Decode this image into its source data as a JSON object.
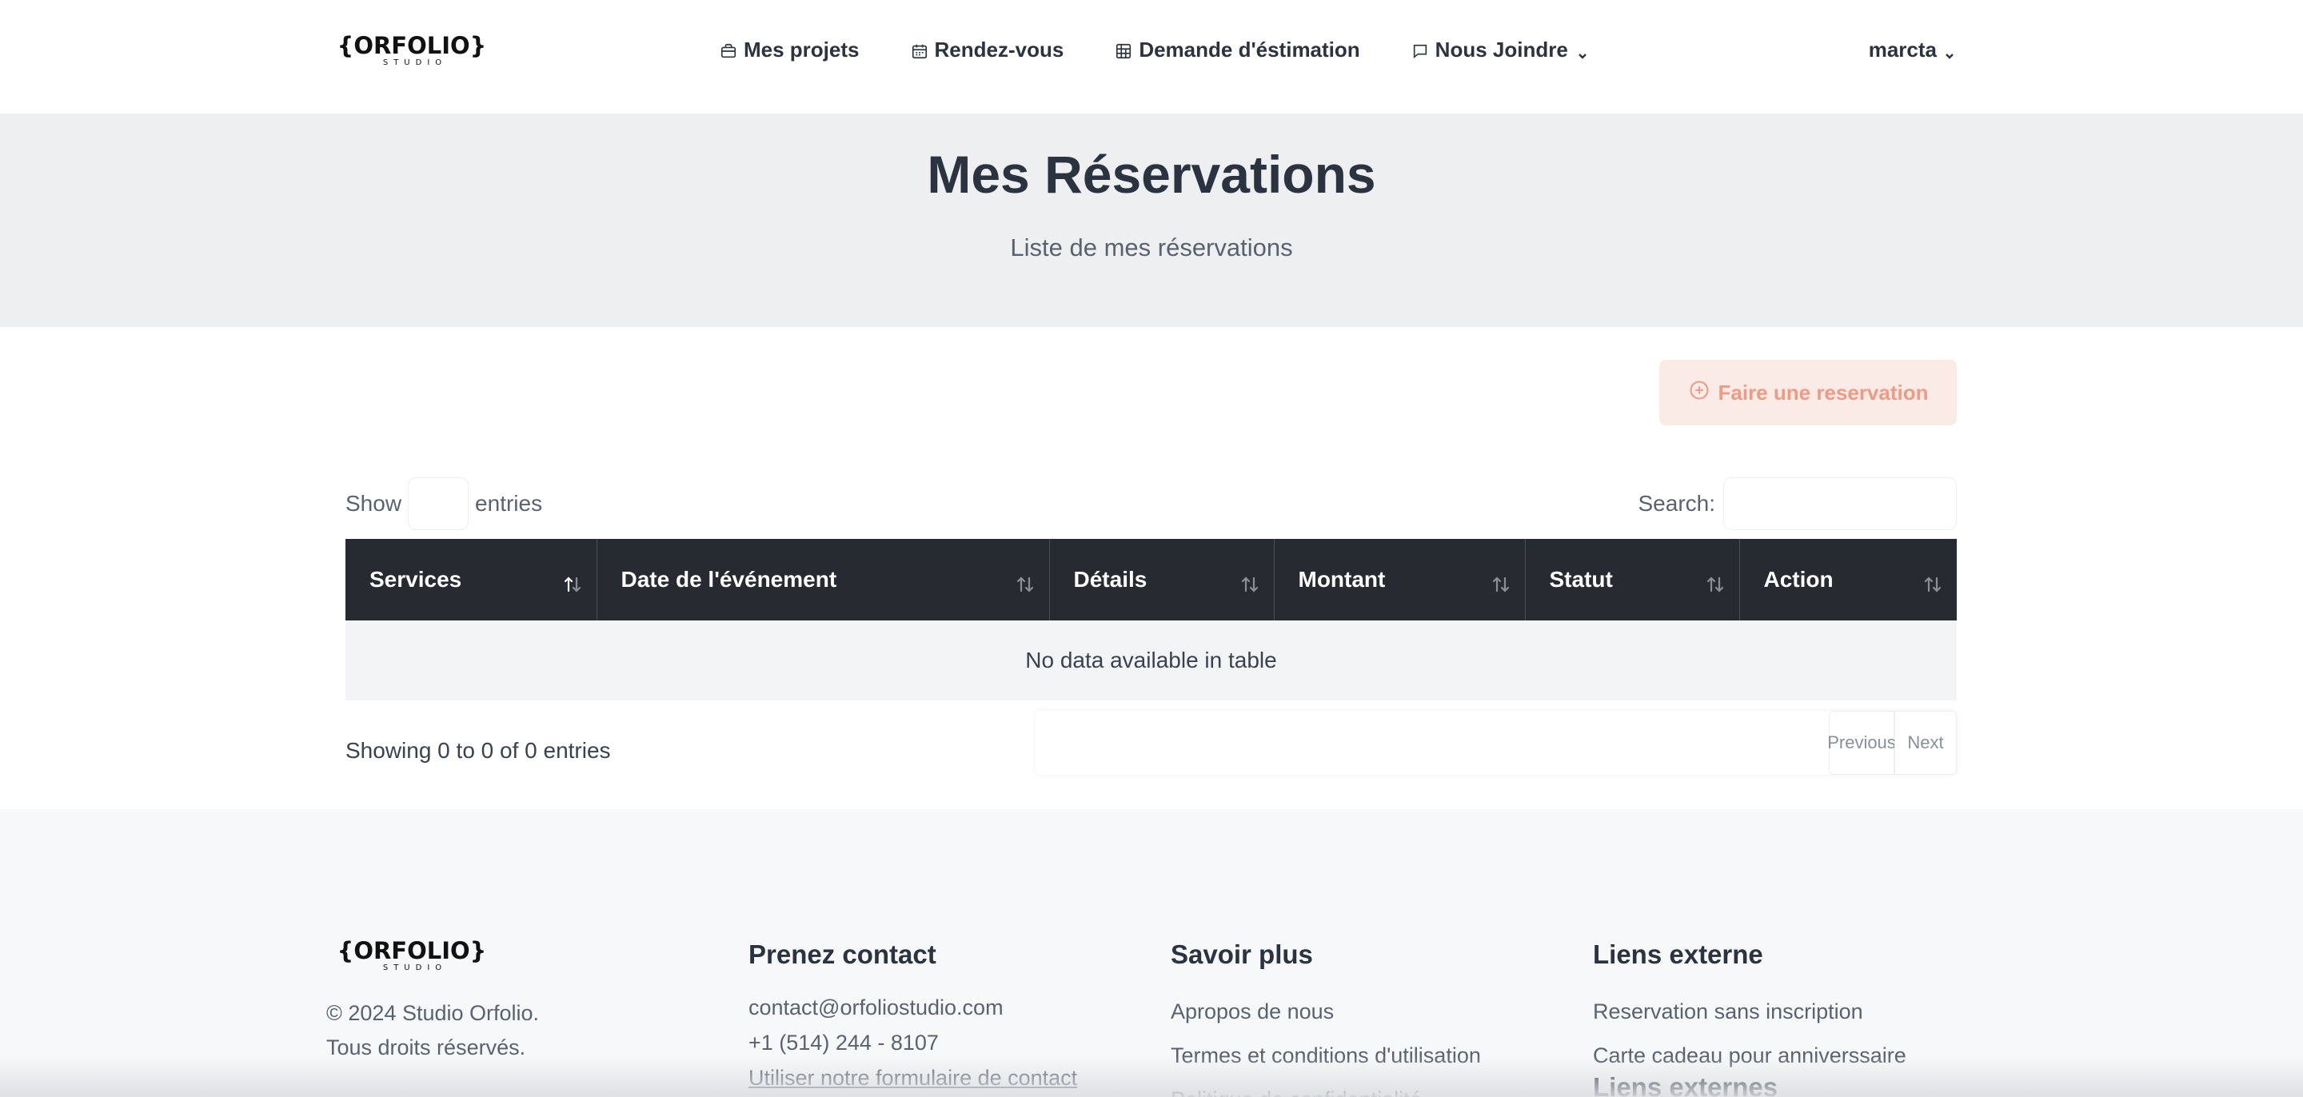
{
  "brand": {
    "logo_main": "{ORFOLIO}",
    "logo_sub": "STUDIO"
  },
  "nav": {
    "items": [
      {
        "label": "Mes projets",
        "icon": "briefcase-icon"
      },
      {
        "label": "Rendez-vous",
        "icon": "calendar-icon"
      },
      {
        "label": "Demande d'éstimation",
        "icon": "calculator-icon"
      },
      {
        "label": "Nous Joindre",
        "icon": "chat-icon"
      }
    ],
    "user": "marcta"
  },
  "hero": {
    "title": "Mes Réservations",
    "subtitle": "Liste de mes réservations"
  },
  "actions": {
    "reserve_label": "Faire une reservation"
  },
  "table": {
    "length_prefix": "Show",
    "length_suffix": "entries",
    "length_value": "",
    "search_label": "Search:",
    "search_value": "",
    "columns": [
      "Services",
      "Date de l'événement",
      "Détails",
      "Montant",
      "Statut",
      "Action"
    ],
    "empty_message": "No data available in table",
    "info": "Showing 0 to 0 of 0 entries",
    "prev_label": "Previous",
    "next_label": "Next"
  },
  "footer": {
    "copyright_line1": "© 2024 Studio Orfolio.",
    "copyright_line2": "Tous droits réservés.",
    "contact": {
      "title": "Prenez contact",
      "email": "contact@orfoliostudio.com",
      "phone": "+1 (514) 244 - 8107",
      "form_link": "Utiliser notre formulaire de contact"
    },
    "savoir": {
      "title": "Savoir plus",
      "links": [
        "Apropos de nous",
        "Termes et conditions d'utilisation",
        "Politique de confidentialité"
      ]
    },
    "liens": {
      "title": "Liens externe",
      "links": [
        "Reservation sans inscription",
        "Carte cadeau pour anniverssaire"
      ],
      "title2": "Liens externes"
    }
  },
  "colors": {
    "header_dark": "#272a31",
    "accent_soft": "#fbebe7",
    "accent_text": "#ef9a85",
    "hero_bg": "#eeeff0"
  }
}
